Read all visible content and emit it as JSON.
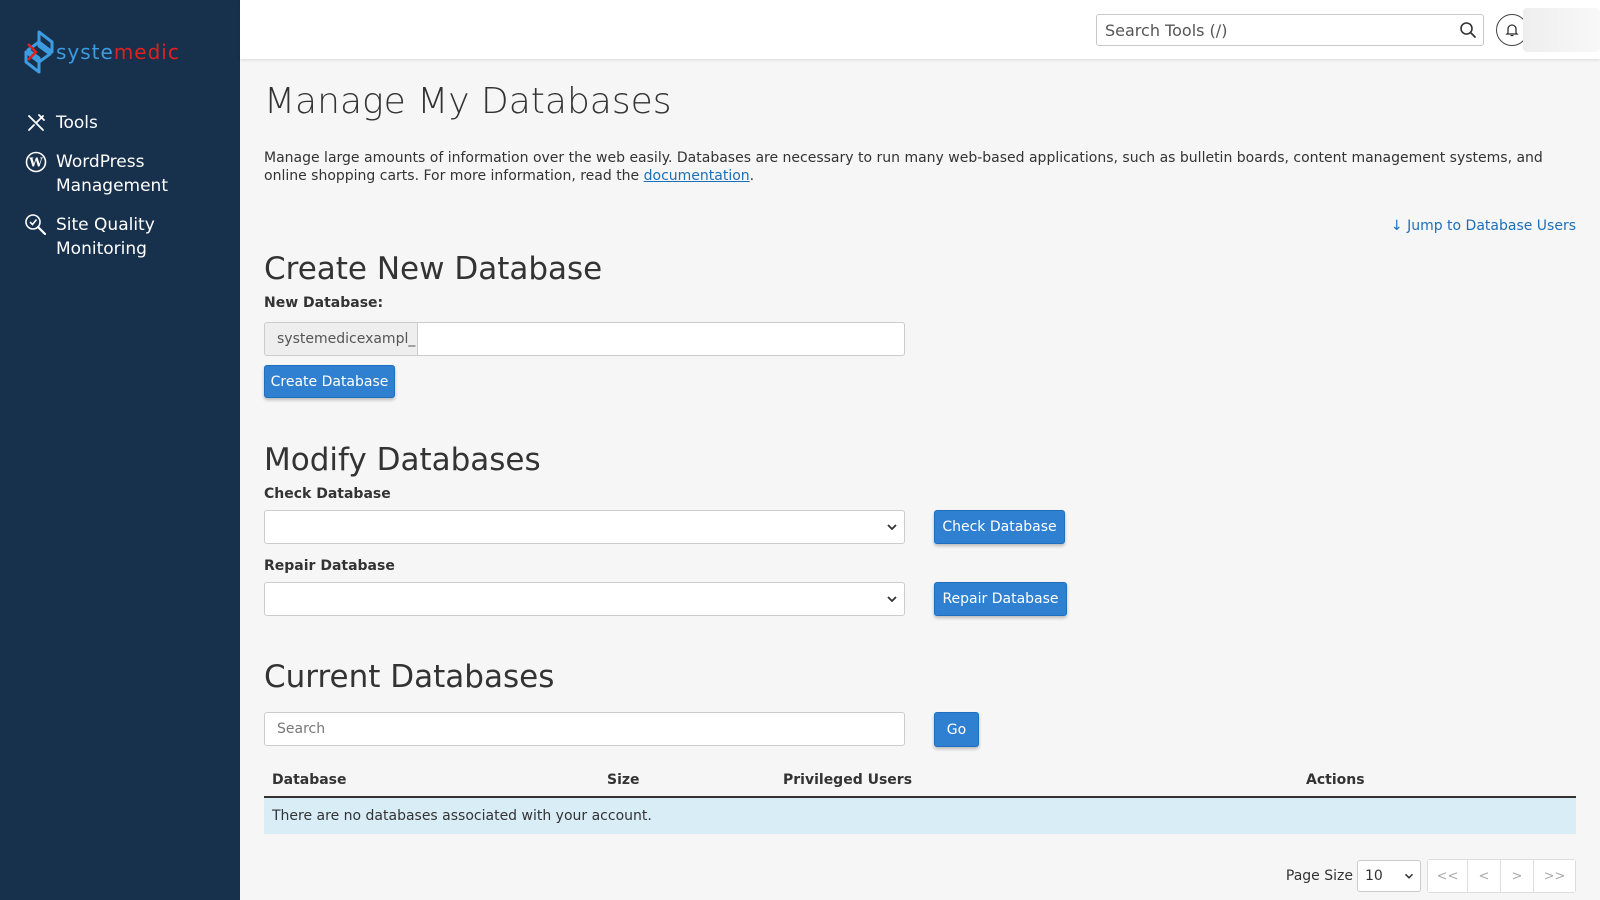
{
  "brand": {
    "logo_part_a": "syste",
    "logo_part_b": "medic",
    "color_a": "#3d9be0",
    "color_b": "#e02020",
    "sidebar_bg": "#17304c"
  },
  "sidebar": {
    "items": [
      {
        "label": "Tools",
        "icon": "tools-icon"
      },
      {
        "label": "WordPress Management",
        "icon": "wordpress-icon"
      },
      {
        "label": "Site Quality Monitoring",
        "icon": "site-quality-icon"
      }
    ]
  },
  "topbar": {
    "search_placeholder": "Search Tools (/)"
  },
  "page": {
    "title": "Manage My Databases",
    "description_before": "Manage large amounts of information over the web easily. Databases are necessary to run many web-based applications, such as bulletin boards, content management systems, and online shopping carts. For more information, read the ",
    "description_link": "documentation",
    "description_after": ".",
    "jump_link": "Jump to Database Users"
  },
  "create": {
    "heading": "Create New Database",
    "label": "New Database:",
    "prefix": "systemedicexampl_",
    "input_value": "",
    "button": "Create Database"
  },
  "modify": {
    "heading": "Modify Databases",
    "check_label": "Check Database",
    "check_selected": "",
    "check_button": "Check Database",
    "repair_label": "Repair Database",
    "repair_selected": "",
    "repair_button": "Repair Database"
  },
  "current": {
    "heading": "Current Databases",
    "search_placeholder": "Search",
    "go_button": "Go",
    "columns": [
      "Database",
      "Size",
      "Privileged Users",
      "Actions"
    ],
    "empty_message": "There are no databases associated with your account."
  },
  "pager": {
    "page_size_label": "Page Size",
    "page_size_value": "10",
    "first": "<<",
    "prev": "<",
    "next": ">",
    "last": ">>"
  },
  "colors": {
    "primary_button": "#2f80d1",
    "link": "#1d6fb8",
    "empty_row_bg": "#d9edf7"
  }
}
